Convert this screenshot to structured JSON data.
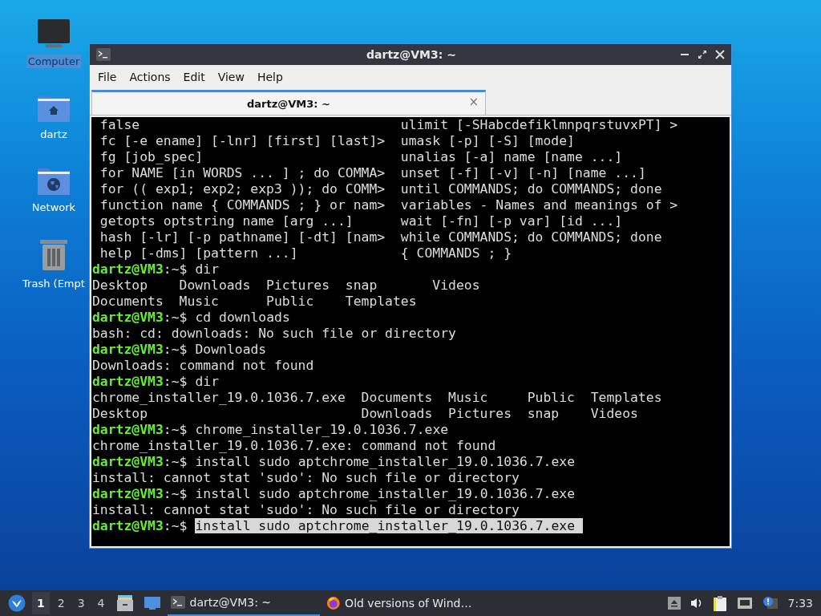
{
  "desktop_icons": [
    {
      "kind": "computer",
      "label": "Computer",
      "selected": true
    },
    {
      "kind": "home",
      "label": "dartz",
      "selected": false
    },
    {
      "kind": "network",
      "label": "Network",
      "selected": false
    },
    {
      "kind": "trash",
      "label": "Trash (Empt",
      "selected": false
    }
  ],
  "window": {
    "title": "dartz@VM3: ~",
    "menu": [
      "File",
      "Actions",
      "Edit",
      "View",
      "Help"
    ],
    "tabs": [
      {
        "label": "dartz@VM3: ~",
        "selected": true,
        "close": "×"
      }
    ],
    "terminal": [
      {
        "kind": "output",
        "text": " false                                 ulimit [-SHabcdefiklmnpqrstuvxPT] >"
      },
      {
        "kind": "output",
        "text": " fc [-e ename] [-lnr] [first] [last]>  umask [-p] [-S] [mode]"
      },
      {
        "kind": "output",
        "text": " fg [job_spec]                         unalias [-a] name [name ...]"
      },
      {
        "kind": "output",
        "text": " for NAME [in WORDS ... ] ; do COMMA>  unset [-f] [-v] [-n] [name ...]"
      },
      {
        "kind": "output",
        "text": " for (( exp1; exp2; exp3 )); do COMM>  until COMMANDS; do COMMANDS; done"
      },
      {
        "kind": "output",
        "text": " function name { COMMANDS ; } or nam>  variables - Names and meanings of >"
      },
      {
        "kind": "output",
        "text": " getopts optstring name [arg ...]      wait [-fn] [-p var] [id ...]"
      },
      {
        "kind": "output",
        "text": " hash [-lr] [-p pathname] [-dt] [nam>  while COMMANDS; do COMMANDS; done"
      },
      {
        "kind": "output",
        "text": " help [-dms] [pattern ...]             { COMMANDS ; }"
      },
      {
        "kind": "prompt",
        "user": "dartz@VM3",
        "path": ":~$",
        "command": "dir",
        "selected": false
      },
      {
        "kind": "output",
        "text": "Desktop    Downloads  Pictures  snap       Videos"
      },
      {
        "kind": "output",
        "text": "Documents  Music      Public    Templates"
      },
      {
        "kind": "prompt",
        "user": "dartz@VM3",
        "path": ":~$",
        "command": "cd downloads",
        "selected": false
      },
      {
        "kind": "output",
        "text": "bash: cd: downloads: No such file or directory"
      },
      {
        "kind": "prompt",
        "user": "dartz@VM3",
        "path": ":~$",
        "command": "Downloads",
        "selected": false
      },
      {
        "kind": "output",
        "text": "Downloads: command not found"
      },
      {
        "kind": "prompt",
        "user": "dartz@VM3",
        "path": ":~$",
        "command": "dir",
        "selected": false
      },
      {
        "kind": "output",
        "text": "chrome_installer_19.0.1036.7.exe  Documents  Music     Public  Templates"
      },
      {
        "kind": "output",
        "text": "Desktop                           Downloads  Pictures  snap    Videos"
      },
      {
        "kind": "prompt",
        "user": "dartz@VM3",
        "path": ":~$",
        "command": "chrome_installer_19.0.1036.7.exe",
        "selected": false
      },
      {
        "kind": "output",
        "text": "chrome_installer_19.0.1036.7.exe: command not found"
      },
      {
        "kind": "prompt",
        "user": "dartz@VM3",
        "path": ":~$",
        "command": "install sudo aptchrome_installer_19.0.1036.7.exe",
        "selected": false
      },
      {
        "kind": "output",
        "text": "install: cannot stat 'sudo': No such file or directory"
      },
      {
        "kind": "prompt",
        "user": "dartz@VM3",
        "path": ":~$",
        "command": "install sudo aptchrome_installer_19.0.1036.7.exe",
        "selected": false
      },
      {
        "kind": "output",
        "text": "install: cannot stat 'sudo': No such file or directory"
      },
      {
        "kind": "prompt",
        "user": "dartz@VM3",
        "path": ":~$",
        "command": "install sudo aptchrome_installer_19.0.1036.7.exe ",
        "selected": true
      }
    ]
  },
  "taskbar": {
    "workspaces": [
      {
        "label": "1",
        "selected": true
      },
      {
        "label": "2",
        "selected": false
      },
      {
        "label": "3",
        "selected": false
      },
      {
        "label": "4",
        "selected": false
      }
    ],
    "tasks": [
      {
        "kind": "terminal",
        "label": "dartz@VM3: ~",
        "selected": true
      },
      {
        "kind": "browser",
        "label": "Old versions of Wind…",
        "selected": false
      }
    ],
    "clock": "7:33"
  }
}
